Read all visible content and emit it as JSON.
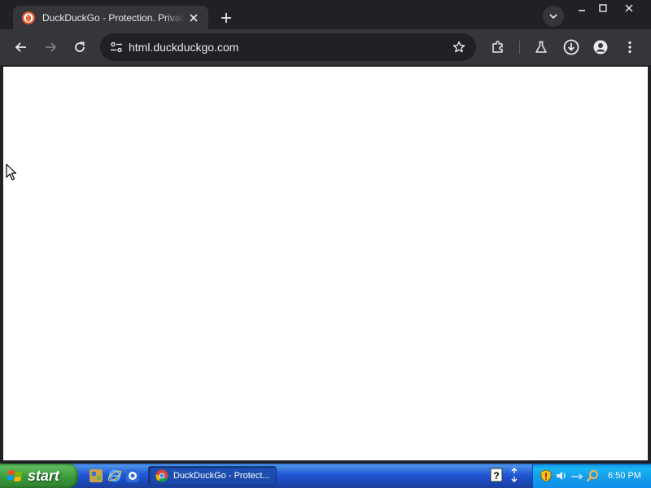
{
  "browser": {
    "tab": {
      "title": "DuckDuckGo - Protection. Privacy. Peace of mind.",
      "favicon": "duckduckgo-icon",
      "close_icon": "close-icon"
    },
    "new_tab_icon": "plus-icon",
    "tab_search_icon": "chevron-down-icon",
    "window_controls": [
      "minimize-icon",
      "maximize-icon",
      "close-icon"
    ],
    "toolbar": {
      "back_icon": "back-arrow-icon",
      "forward_icon": "forward-arrow-icon",
      "reload_icon": "reload-icon",
      "site_info_icon": "site-settings-icon",
      "url": "html.duckduckgo.com",
      "bookmark_icon": "star-icon",
      "extensions_icon": "puzzle-icon",
      "labs_icon": "flask-icon",
      "downloads_icon": "download-icon",
      "profile_icon": "avatar-icon",
      "menu_icon": "kebab-menu-icon"
    }
  },
  "taskbar": {
    "start_label": "start",
    "quick_launch": [
      "app-icon",
      "internet-explorer-icon",
      "chrome-icon"
    ],
    "task_button_label": "DuckDuckGo - Protect...",
    "tray_icons": [
      "help-icon",
      "network-icon",
      "shield-icon",
      "volume-icon",
      "display-icon",
      "search-icon"
    ],
    "clock": "6:50 PM"
  },
  "colors": {
    "tabstrip_bg": "#202124",
    "toolbar_bg": "#35363a",
    "page_bg": "#ffffff",
    "taskbar_blue": "#2157d7",
    "start_green": "#3a9a3a",
    "tray_blue": "#139beb"
  }
}
